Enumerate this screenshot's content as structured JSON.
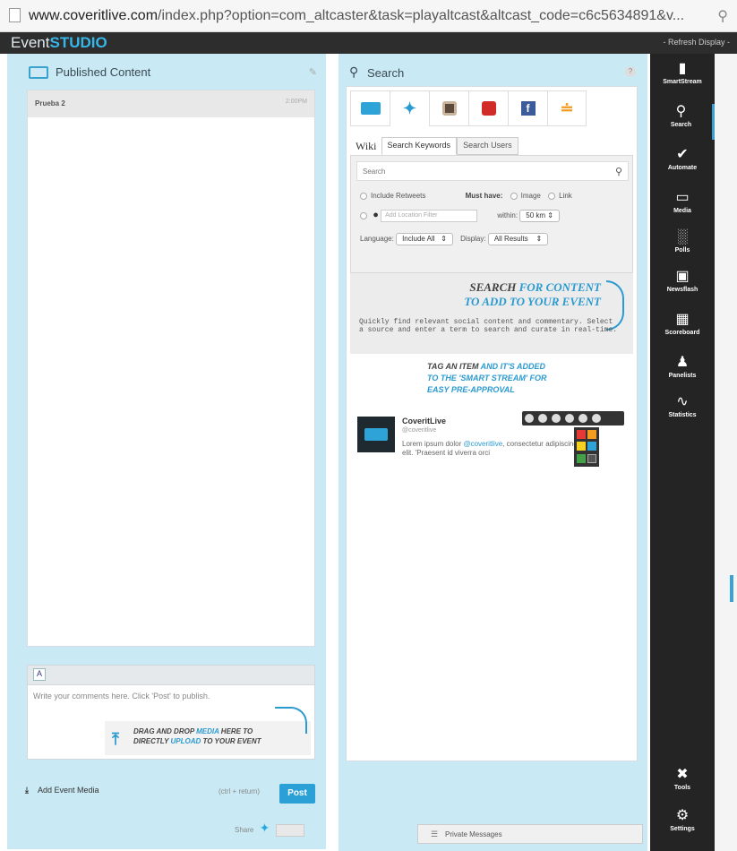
{
  "browser": {
    "url_host": "www.coveritlive.com",
    "url_rest": "/index.php?option=com_altcaster&task=playaltcast&altcast_code=c6c5634891&v..."
  },
  "app": {
    "logo_event": "Event",
    "logo_studio": "STUDIO",
    "refresh_label": "- Refresh Display -"
  },
  "published": {
    "title": "Published Content",
    "items": [
      {
        "name": "Prueba 2",
        "time": "2:00PM"
      }
    ]
  },
  "composer": {
    "placeholder": "Write your comments here. Click 'Post' to publish.",
    "drop_hint_line1a": "Drag and Drop ",
    "drop_hint_line1b": "Media",
    "drop_hint_line1c": " here to",
    "drop_hint_line2a": "directly ",
    "drop_hint_line2b": "upload",
    "drop_hint_line2c": " to your event",
    "add_media_label": "Add Event Media",
    "shortcut_label": "(ctrl + return)",
    "post_label": "Post",
    "share_label": "Share"
  },
  "search": {
    "title": "Search",
    "wiki_label": "Wiki",
    "tab_keywords": "Search Keywords",
    "tab_users": "Search Users",
    "input_placeholder": "Search",
    "include_retweets": "Include Retweets",
    "must_have_label": "Must have:",
    "opt_image": "Image",
    "opt_link": "Link",
    "location_placeholder": "Add Location Filter",
    "within_label": "within:",
    "within_value": "50 km",
    "language_label": "Language:",
    "language_value": "Include All",
    "display_label": "Display:",
    "display_value": "All Results"
  },
  "hint_search": {
    "line1a": "Search",
    "line1b": " for content",
    "line2": "to add to your Event",
    "desc": "Quickly find relevant social content and commentary. Select a source and enter a term to search and curate in real-time."
  },
  "hint_tag": {
    "line1a": "Tag an item",
    "line1b": " and it's added",
    "line2": "to the 'Smart Stream' for",
    "line3": "easy pre-approval"
  },
  "sample_post": {
    "author": "CoveritLive",
    "handle": "@coveritlive",
    "body_a": "Lorem ipsum dolor ",
    "body_link": "@coveritlive",
    "body_b": ", consectetur adipiscing elit. 'Praesent id viverra orci"
  },
  "nav": [
    {
      "icon": "smartstream-icon",
      "label": "SmartStream"
    },
    {
      "icon": "search-icon",
      "label": "Search"
    },
    {
      "icon": "automate-icon",
      "label": "Automate"
    },
    {
      "icon": "media-icon",
      "label": "Media"
    },
    {
      "icon": "polls-icon",
      "label": "Polls"
    },
    {
      "icon": "newsflash-icon",
      "label": "Newsflash"
    },
    {
      "icon": "scoreboard-icon",
      "label": "Scoreboard"
    },
    {
      "icon": "panelists-icon",
      "label": "Panelists"
    },
    {
      "icon": "statistics-icon",
      "label": "Statistics"
    },
    {
      "icon": "tools-icon",
      "label": "Tools"
    },
    {
      "icon": "settings-icon",
      "label": "Settings"
    }
  ],
  "private_messages_label": "Private Messages",
  "colors": {
    "accent": "#2a9ad0",
    "panel_bg": "#c9e9f4",
    "sidebar_bg": "#242424"
  }
}
